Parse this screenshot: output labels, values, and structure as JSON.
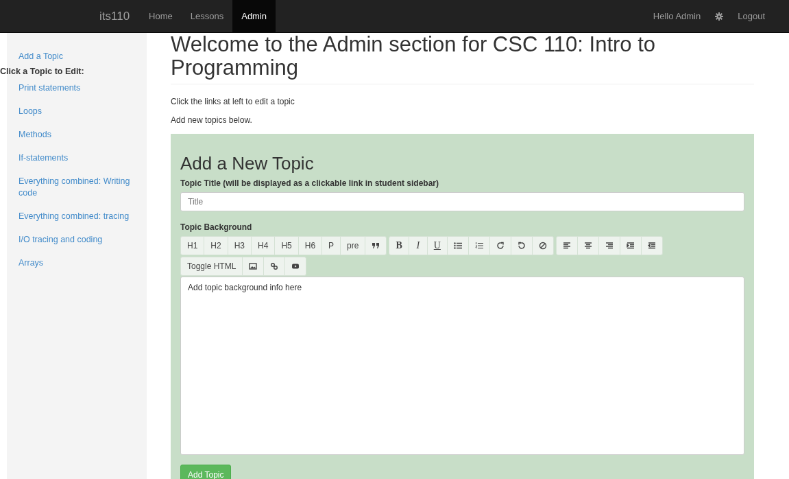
{
  "navbar": {
    "brand": "its110",
    "links": [
      {
        "label": "Home",
        "selected": false
      },
      {
        "label": "Lessons",
        "selected": false
      },
      {
        "label": "Admin",
        "selected": true
      }
    ],
    "greeting": "Hello Admin",
    "logout": "Logout"
  },
  "sidebar": {
    "add_link": "Add a Topic",
    "heading": "Click a Topic to Edit:",
    "topics": [
      "Print statements",
      "Loops",
      "Methods",
      "If-statements",
      "Everything combined: Writing code",
      "Everything combined: tracing",
      "I/O tracing and coding",
      "Arrays"
    ]
  },
  "main": {
    "title": "Welcome to the Admin section for CSC 110: Intro to Programming",
    "intro": [
      "Click the links at left to edit a topic",
      "Add new topics below."
    ],
    "form": {
      "heading": "Add a New Topic",
      "title_label": "Topic Title (will be displayed as a clickable link in student sidebar)",
      "title_placeholder": "Title",
      "background_label": "Topic Background",
      "toolbar": [
        [
          [
            {
              "kind": "text",
              "label": "H1"
            },
            {
              "kind": "text",
              "label": "H2"
            },
            {
              "kind": "text",
              "label": "H3"
            },
            {
              "kind": "text",
              "label": "H4"
            },
            {
              "kind": "text",
              "label": "H5"
            },
            {
              "kind": "text",
              "label": "H6"
            },
            {
              "kind": "text",
              "label": "P"
            },
            {
              "kind": "text",
              "label": "pre"
            },
            {
              "kind": "icon"
            }
          ],
          [
            {
              "kind": "bold",
              "label": "B"
            },
            {
              "kind": "italic",
              "label": "I"
            },
            {
              "kind": "underline",
              "label": "U"
            },
            {
              "kind": "icon"
            },
            {
              "kind": "icon"
            },
            {
              "kind": "icon"
            },
            {
              "kind": "icon"
            },
            {
              "kind": "icon"
            }
          ],
          [
            {
              "kind": "icon"
            },
            {
              "kind": "icon"
            },
            {
              "kind": "icon"
            },
            {
              "kind": "icon"
            },
            {
              "kind": "icon"
            }
          ]
        ],
        [
          [
            {
              "kind": "text",
              "label": "Toggle HTML"
            },
            {
              "kind": "icon"
            },
            {
              "kind": "icon"
            },
            {
              "kind": "icon"
            }
          ]
        ]
      ],
      "editor_placeholder": "Add topic background info here",
      "submit": "Add Topic"
    }
  }
}
